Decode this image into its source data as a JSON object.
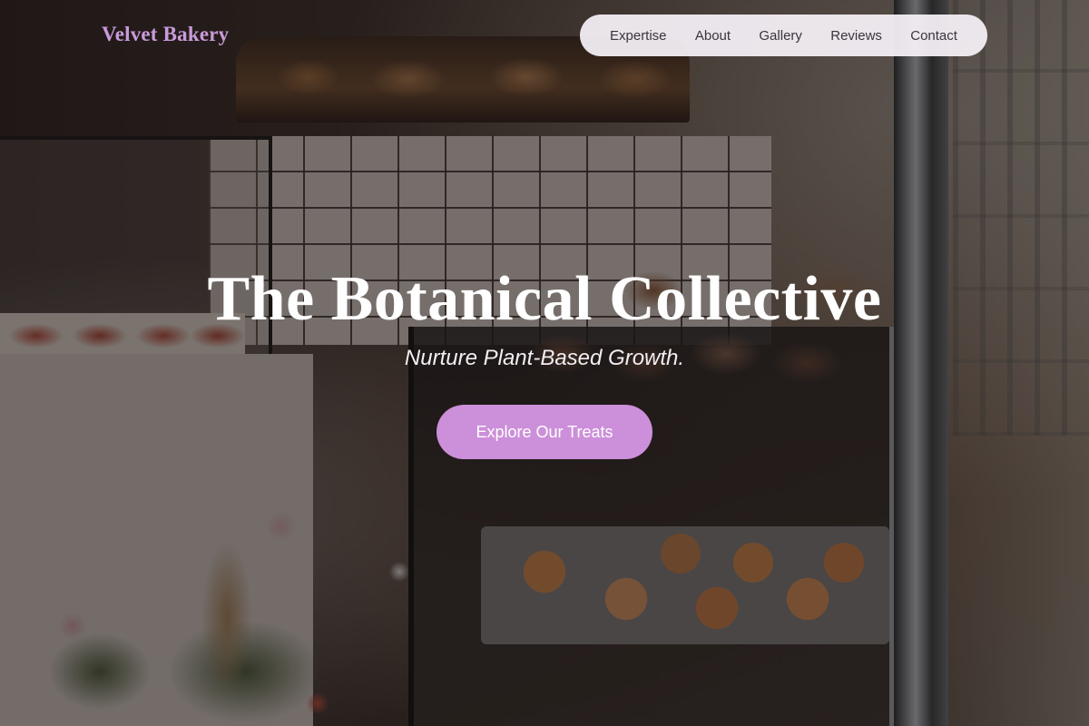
{
  "brand": {
    "name": "Velvet Bakery"
  },
  "nav": {
    "items": [
      {
        "label": "Expertise"
      },
      {
        "label": "About"
      },
      {
        "label": "Gallery"
      },
      {
        "label": "Reviews"
      },
      {
        "label": "Contact"
      }
    ]
  },
  "hero": {
    "title": "The Botanical Collective",
    "subtitle": "Nurture Plant-Based Growth.",
    "cta_label": "Explore Our Treats"
  },
  "colors": {
    "accent": "#cc8fd9",
    "logo": "#c99bd9",
    "nav_background": "#f6f2f8"
  }
}
